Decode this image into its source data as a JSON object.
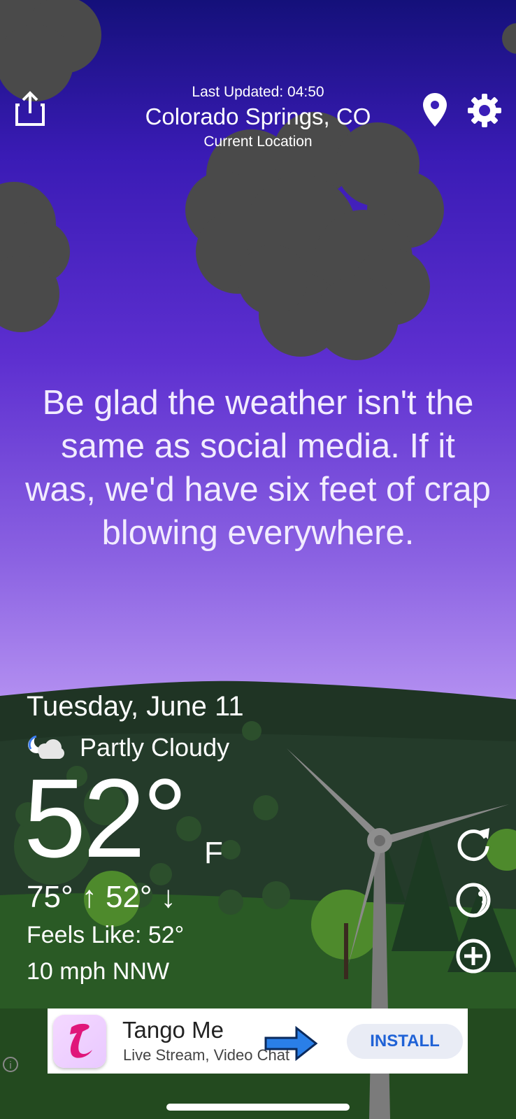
{
  "header": {
    "last_updated": "Last Updated: 04:50",
    "city": "Colorado Springs, CO",
    "location_label": "Current Location"
  },
  "icons": {
    "share": "share-icon",
    "location": "location-pin-icon",
    "settings": "gear-icon",
    "refresh": "refresh-icon",
    "moon": "moon-phase-icon",
    "add": "plus-circle-icon",
    "weather": "partly-cloudy-night-icon"
  },
  "quote": "Be glad the weather isn't the same as social media. If it was, we'd have six feet of crap blowing everywhere.",
  "weather": {
    "date": "Tuesday, June 11",
    "condition": "Partly Cloudy",
    "temperature": "52°",
    "unit": "F",
    "hi_lo": "75° ↑ 52° ↓",
    "feels_like": "Feels Like: 52°",
    "wind": "10 mph NNW"
  },
  "ad": {
    "app_name": "Tango Me",
    "subtitle": "Live Stream, Video Chat",
    "cta": "INSTALL",
    "info": "i"
  },
  "colors": {
    "sky_top": "#14107a",
    "sky_bottom": "#c6a6f3",
    "hill": "#23392a",
    "cloud": "#4a4a4a",
    "install_text": "#1f62d6"
  }
}
